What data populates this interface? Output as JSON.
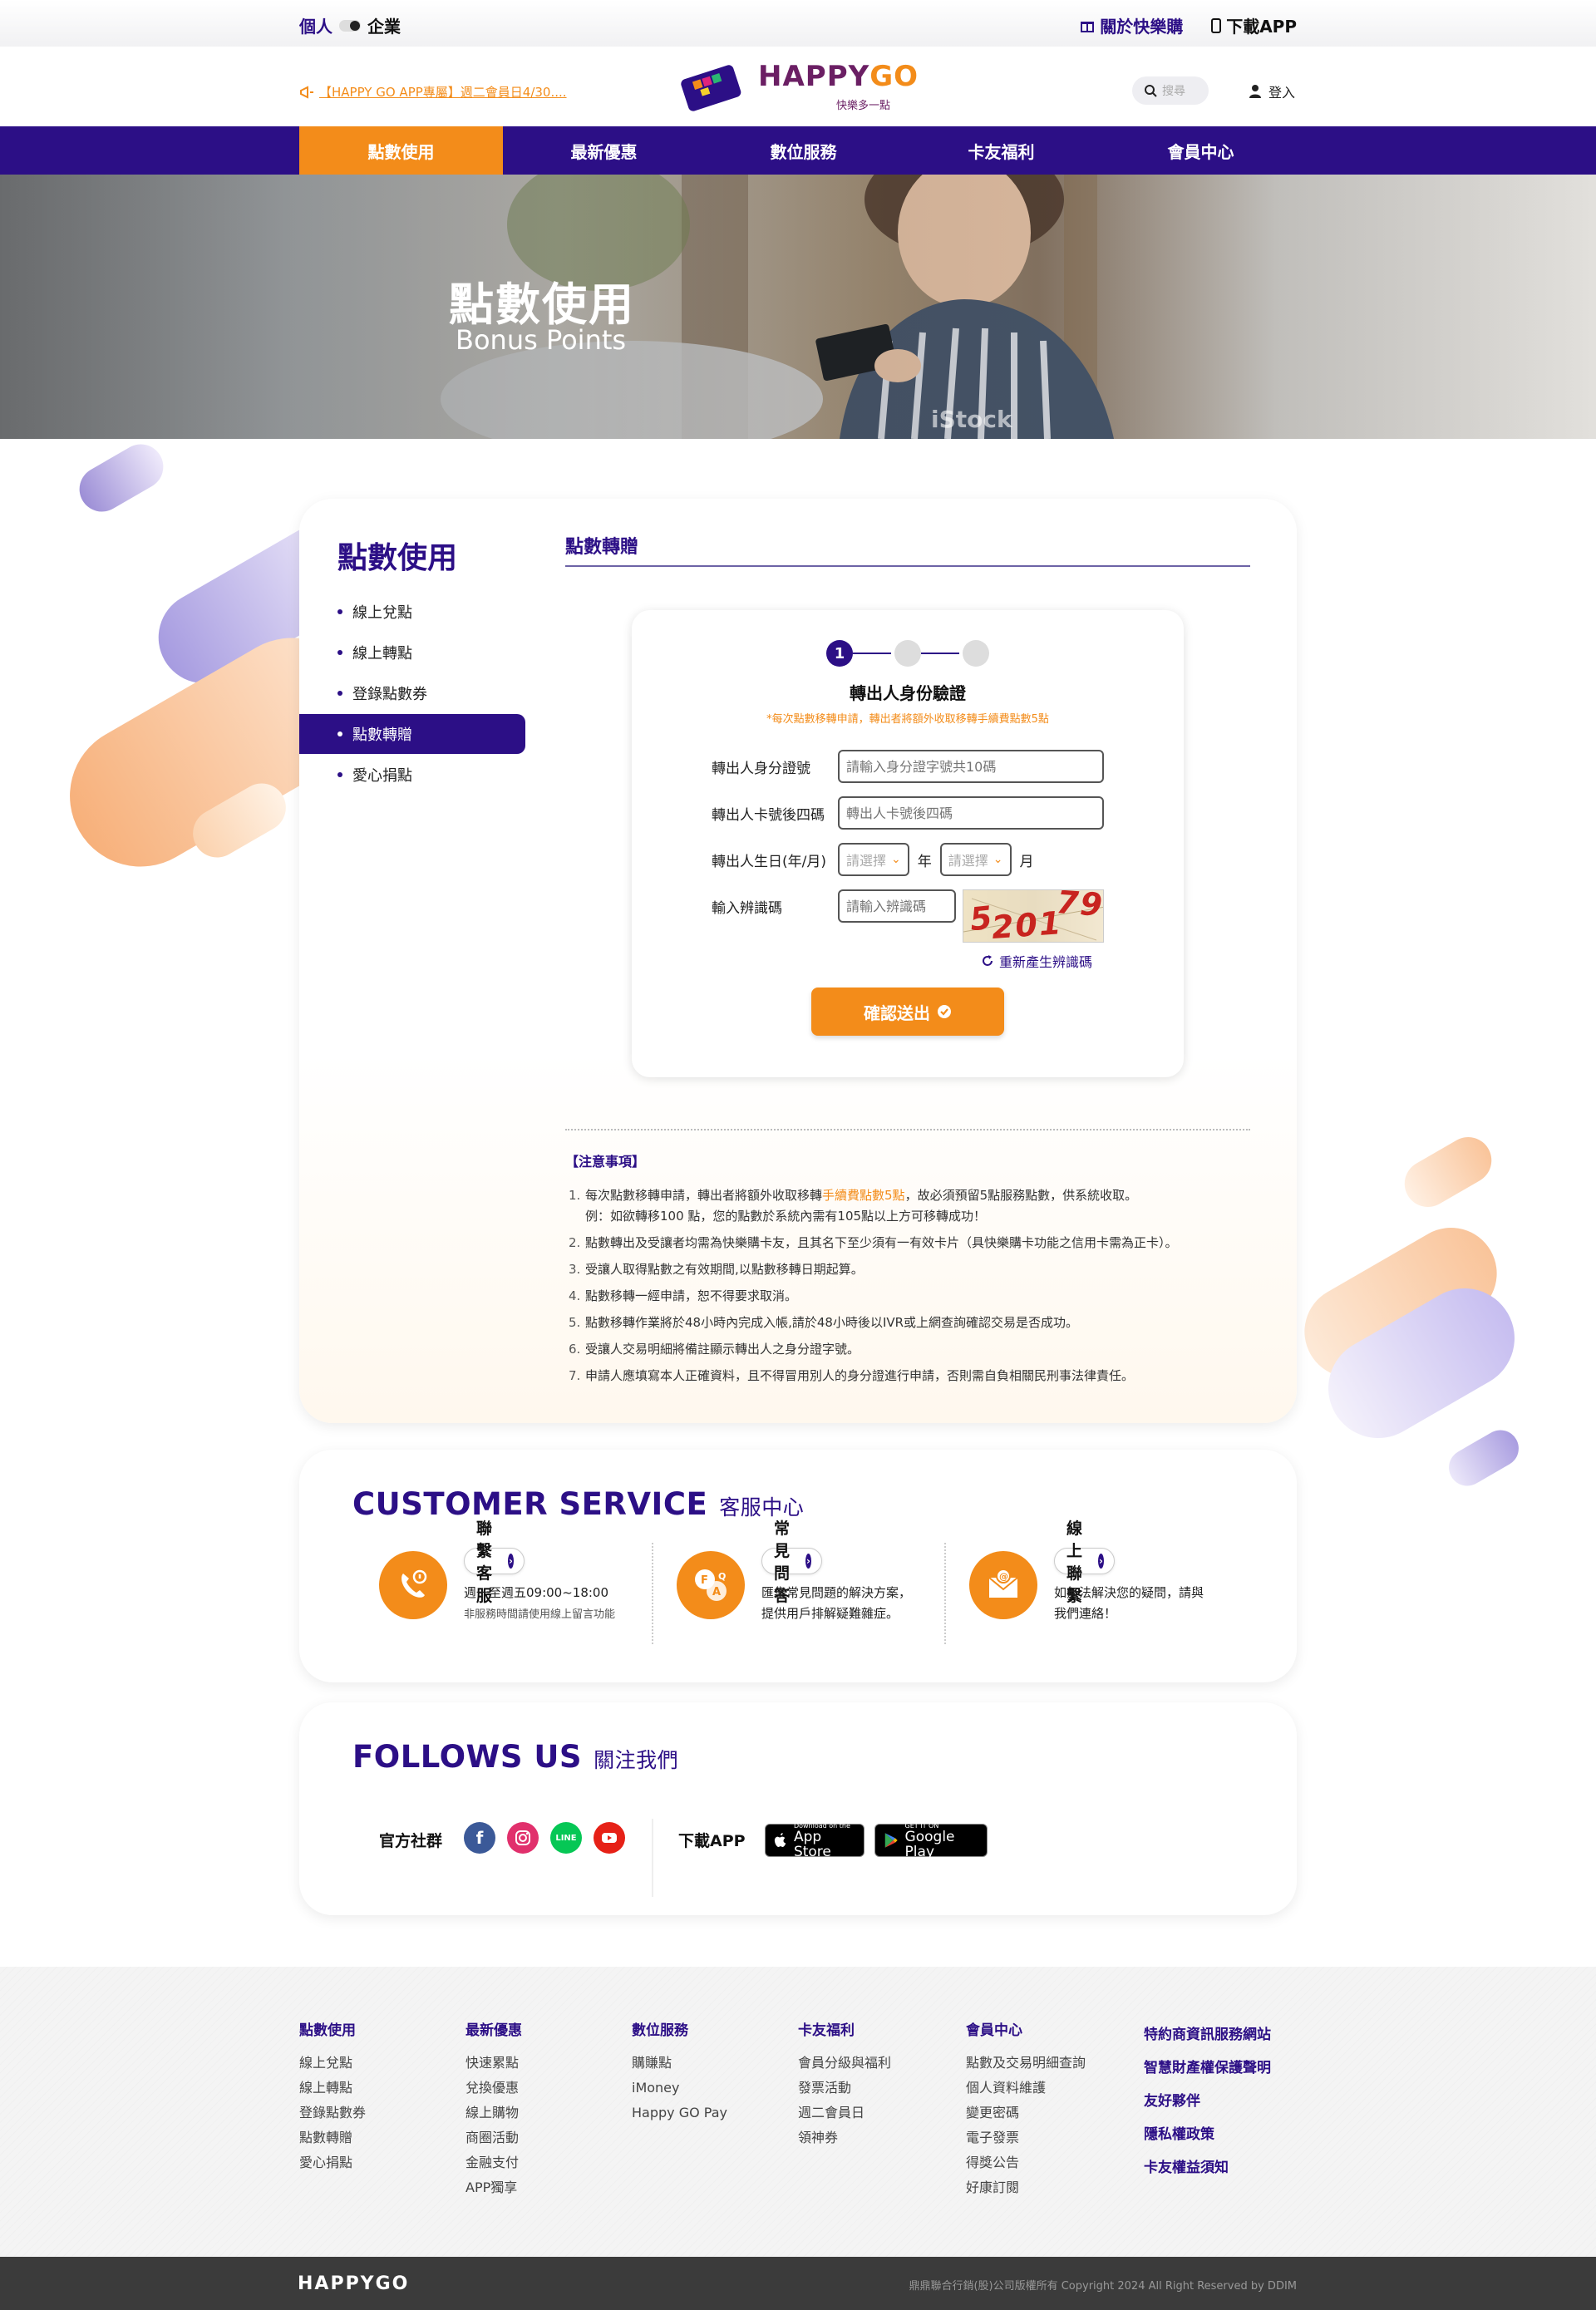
{
  "topbar": {
    "personal": "個人",
    "business": "企業",
    "about": "關於快樂購",
    "download": "下載APP"
  },
  "header": {
    "marquee": "【HAPPY GO APP專屬】週二會員日4/30....",
    "logo_happy": "HAPPY",
    "logo_go": "GO",
    "logo_slogan": "快樂多一點",
    "search_placeholder": "搜尋",
    "login": "登入"
  },
  "nav": [
    "點數使用",
    "最新優惠",
    "數位服務",
    "卡友福利",
    "會員中心"
  ],
  "hero": {
    "title": "點數使用",
    "subtitle": "Bonus Points",
    "watermark": "iStock"
  },
  "sidebar": {
    "title": "點數使用",
    "items": [
      "線上兌點",
      "線上轉點",
      "登錄點數券",
      "點數轉贈",
      "愛心捐點"
    ],
    "active_index": 3
  },
  "section_title": "點數轉贈",
  "form": {
    "step_current": "1",
    "heading": "轉出人身份驗證",
    "note": "*每次點數移轉申請，轉出者將額外收取移轉手續費點數5點",
    "id_label": "轉出人身分證號",
    "id_placeholder": "請輸入身分證字號共10碼",
    "card_label": "轉出人卡號後四碼",
    "card_placeholder": "轉出人卡號後四碼",
    "birth_label": "轉出人生日(年/月)",
    "select_placeholder": "請選擇",
    "year_unit": "年",
    "month_unit": "月",
    "captcha_label": "輸入辨識碼",
    "captcha_placeholder": "請輸入辨識碼",
    "captcha_a": "5",
    "captcha_b": "201",
    "captcha_c": "79",
    "refresh": "重新產生辨識碼",
    "submit": "確認送出"
  },
  "notice": {
    "title": "【注意事項】",
    "items": [
      {
        "pre": "每次點數移轉申請，轉出者將額外收取移轉",
        "hl": "手續費點數5點",
        "post": "，故必須預留5點服務點數，供系統收取。",
        "line2": "例：如欲轉移100 點，您的點數於系統內需有105點以上方可移轉成功！"
      },
      {
        "pre": "點數轉出及受讓者均需為快樂購卡友，且其名下至少須有一有效卡片（具快樂購卡功能之信用卡需為正卡）。",
        "hl": "",
        "post": "",
        "line2": ""
      },
      {
        "pre": "受讓人取得點數之有效期間,以點數移轉日期起算。",
        "hl": "",
        "post": "",
        "line2": ""
      },
      {
        "pre": "點數移轉一經申請，恕不得要求取消。",
        "hl": "",
        "post": "",
        "line2": ""
      },
      {
        "pre": "點數移轉作業將於48小時內完成入帳,請於48小時後以IVR或上網查詢確認交易是否成功。",
        "hl": "",
        "post": "",
        "line2": ""
      },
      {
        "pre": "受讓人交易明細將備註顯示轉出人之身分證字號。",
        "hl": "",
        "post": "",
        "line2": ""
      },
      {
        "pre": "申請人應填寫本人正確資料，且不得冒用別人的身分證進行申請，否則需自負相關民刑事法律責任。",
        "hl": "",
        "post": "",
        "line2": ""
      }
    ]
  },
  "customer_service": {
    "title": "CUSTOMER SERVICE",
    "title_zh": "客服中心",
    "items": [
      {
        "label": "聯繫客服",
        "line1": "週一至週五09:00~18:00",
        "line2": "非服務時間請使用線上留言功能",
        "icon": "phone-icon"
      },
      {
        "label": "常見問答",
        "line1": "匯集常見問題的解決方案，",
        "line2": "提供用戶排解疑難雜症。",
        "icon": "faq-icon"
      },
      {
        "label": "線上聯繫",
        "line1": "如無法解決您的疑問，請與",
        "line2": "我們連絡！",
        "icon": "mail-icon"
      }
    ]
  },
  "follow": {
    "title": "FOLLOWS US",
    "title_zh": "關注我們",
    "social_label": "官方社群",
    "line_text": "LINE",
    "app_label": "下載APP",
    "appstore_small": "Download on the",
    "appstore": "App Store",
    "gplay_small": "GET IT ON",
    "gplay": "Google Play"
  },
  "footer": {
    "columns": [
      {
        "title": "點數使用",
        "links": [
          "線上兌點",
          "線上轉點",
          "登錄點數券",
          "點數轉贈",
          "愛心捐點"
        ]
      },
      {
        "title": "最新優惠",
        "links": [
          "快速累點",
          "兌換優惠",
          "線上購物",
          "商圈活動",
          "金融支付",
          "APP獨享"
        ]
      },
      {
        "title": "數位服務",
        "links": [
          "購賺點",
          "iMoney",
          "Happy GO Pay"
        ]
      },
      {
        "title": "卡友福利",
        "links": [
          "會員分級與福利",
          "發票活動",
          "週二會員日",
          "領神券"
        ]
      },
      {
        "title": "會員中心",
        "links": [
          "點數及交易明細查詢",
          "個人資料維護",
          "變更密碼",
          "電子發票",
          "得獎公告",
          "好康訂閱"
        ]
      }
    ],
    "right_links": [
      "特約商資訊服務網站",
      "智慧財產權保護聲明",
      "友好夥伴",
      "隱私權政策",
      "卡友權益須知"
    ],
    "brand": "HAPPYGO",
    "copyright": "鼎鼎聯合行銷(股)公司版權所有 Copyright 2024 All Right Reserved by DDIM"
  },
  "colors": {
    "brand_purple": "#2c0f86",
    "brand_orange": "#f38c1a"
  }
}
